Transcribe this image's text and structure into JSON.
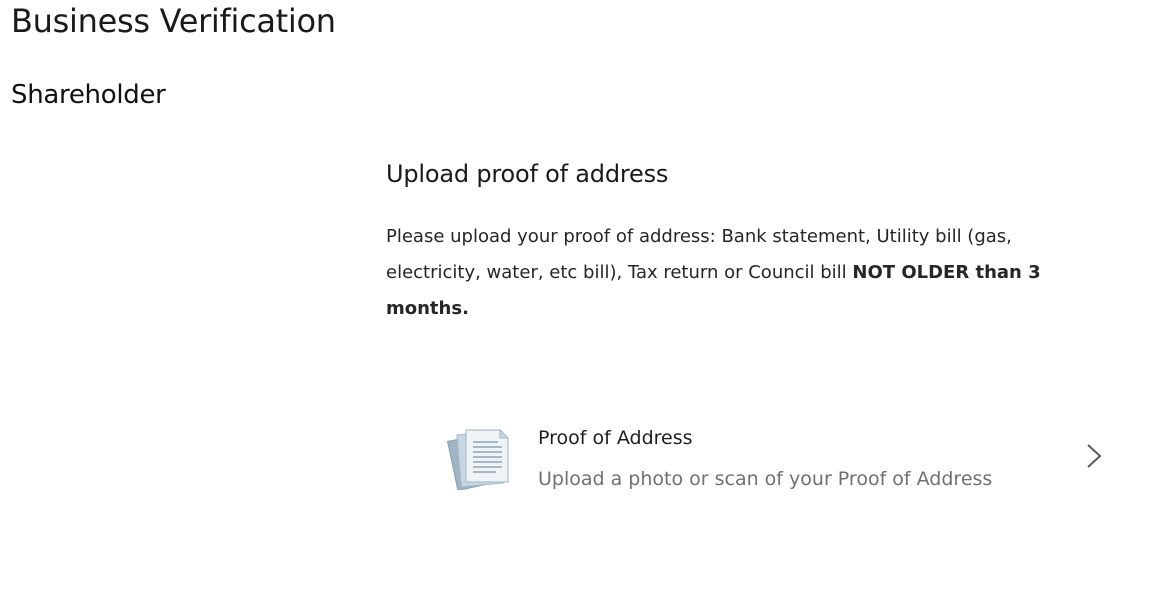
{
  "header": {
    "title": "Business Verification"
  },
  "section": {
    "title": "Shareholder"
  },
  "upload": {
    "heading": "Upload proof of address",
    "instructions_regular": "Please upload your proof of address: Bank statement, Utility bill (gas, electricity, water, etc bill), Tax return or Council bill ",
    "instructions_bold": "NOT OLDER than 3 months."
  },
  "document_option": {
    "icon": "document-icon",
    "title": "Proof of Address",
    "subtitle": "Upload a photo or scan of your Proof of Address",
    "chevron_icon": "chevron-right-icon"
  },
  "colors": {
    "text_primary": "#1a1a1a",
    "text_secondary": "#707070",
    "icon_document": "#b9c9d6"
  }
}
